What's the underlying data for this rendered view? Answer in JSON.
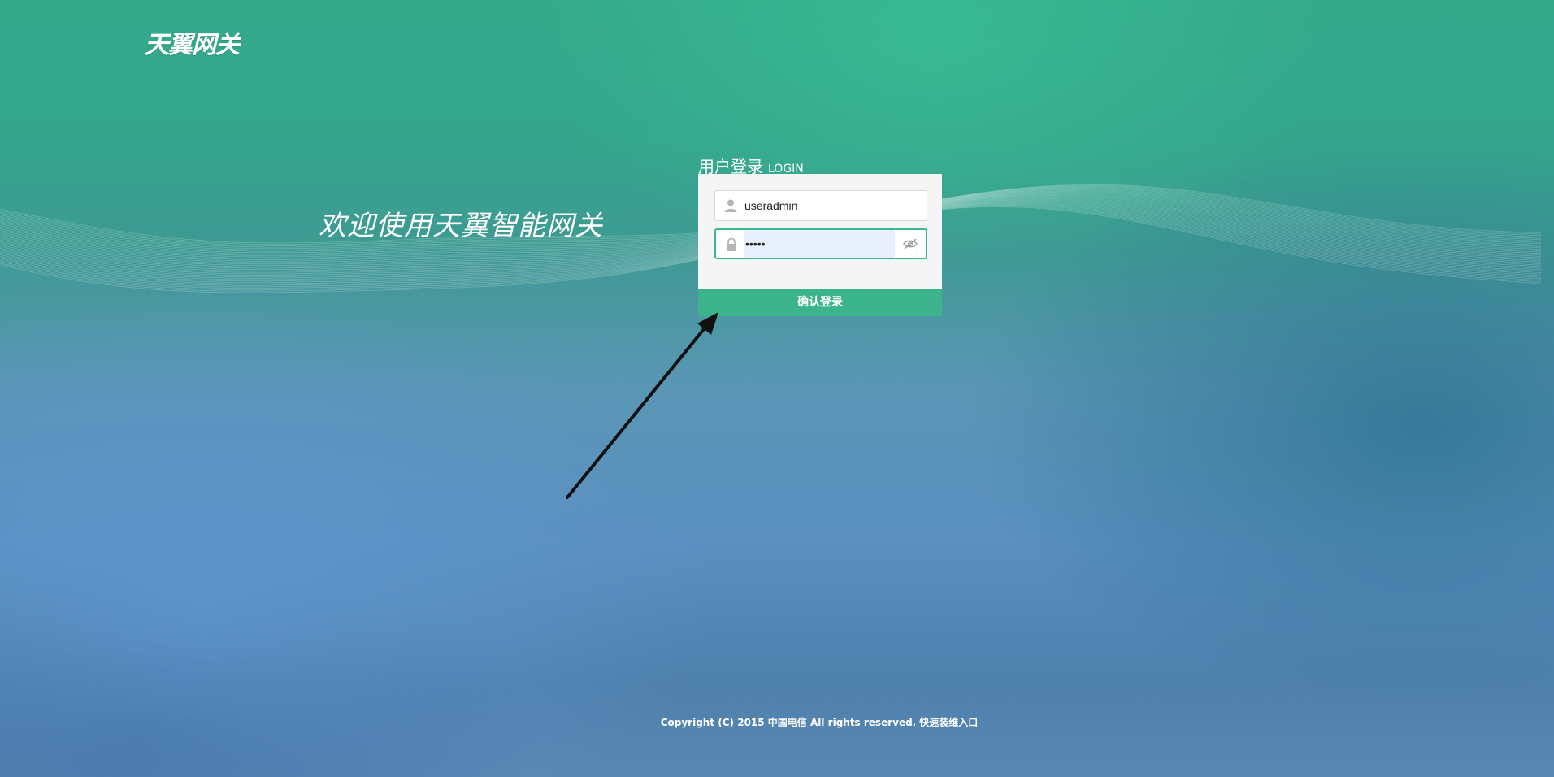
{
  "logo": {
    "text": "天翼网关"
  },
  "welcome": {
    "text": "欢迎使用天翼智能网关"
  },
  "login": {
    "title_cn": "用户登录",
    "title_en": "LOGIN",
    "username": {
      "value": "useradmin",
      "icon": "user-icon"
    },
    "password": {
      "value": "•••••",
      "icon": "lock-icon",
      "toggle_icon": "eye-hidden-icon"
    },
    "submit_label": "确认登录"
  },
  "footer": {
    "copyright": "Copyright (C) 2015 中国电信 All rights reserved.",
    "link": "快速装维入口"
  },
  "colors": {
    "accent": "#3bb48c",
    "field_focus_border": "#3bb995",
    "autofill_bg": "#e8f0fe",
    "annotation_arrow": "#111111"
  }
}
